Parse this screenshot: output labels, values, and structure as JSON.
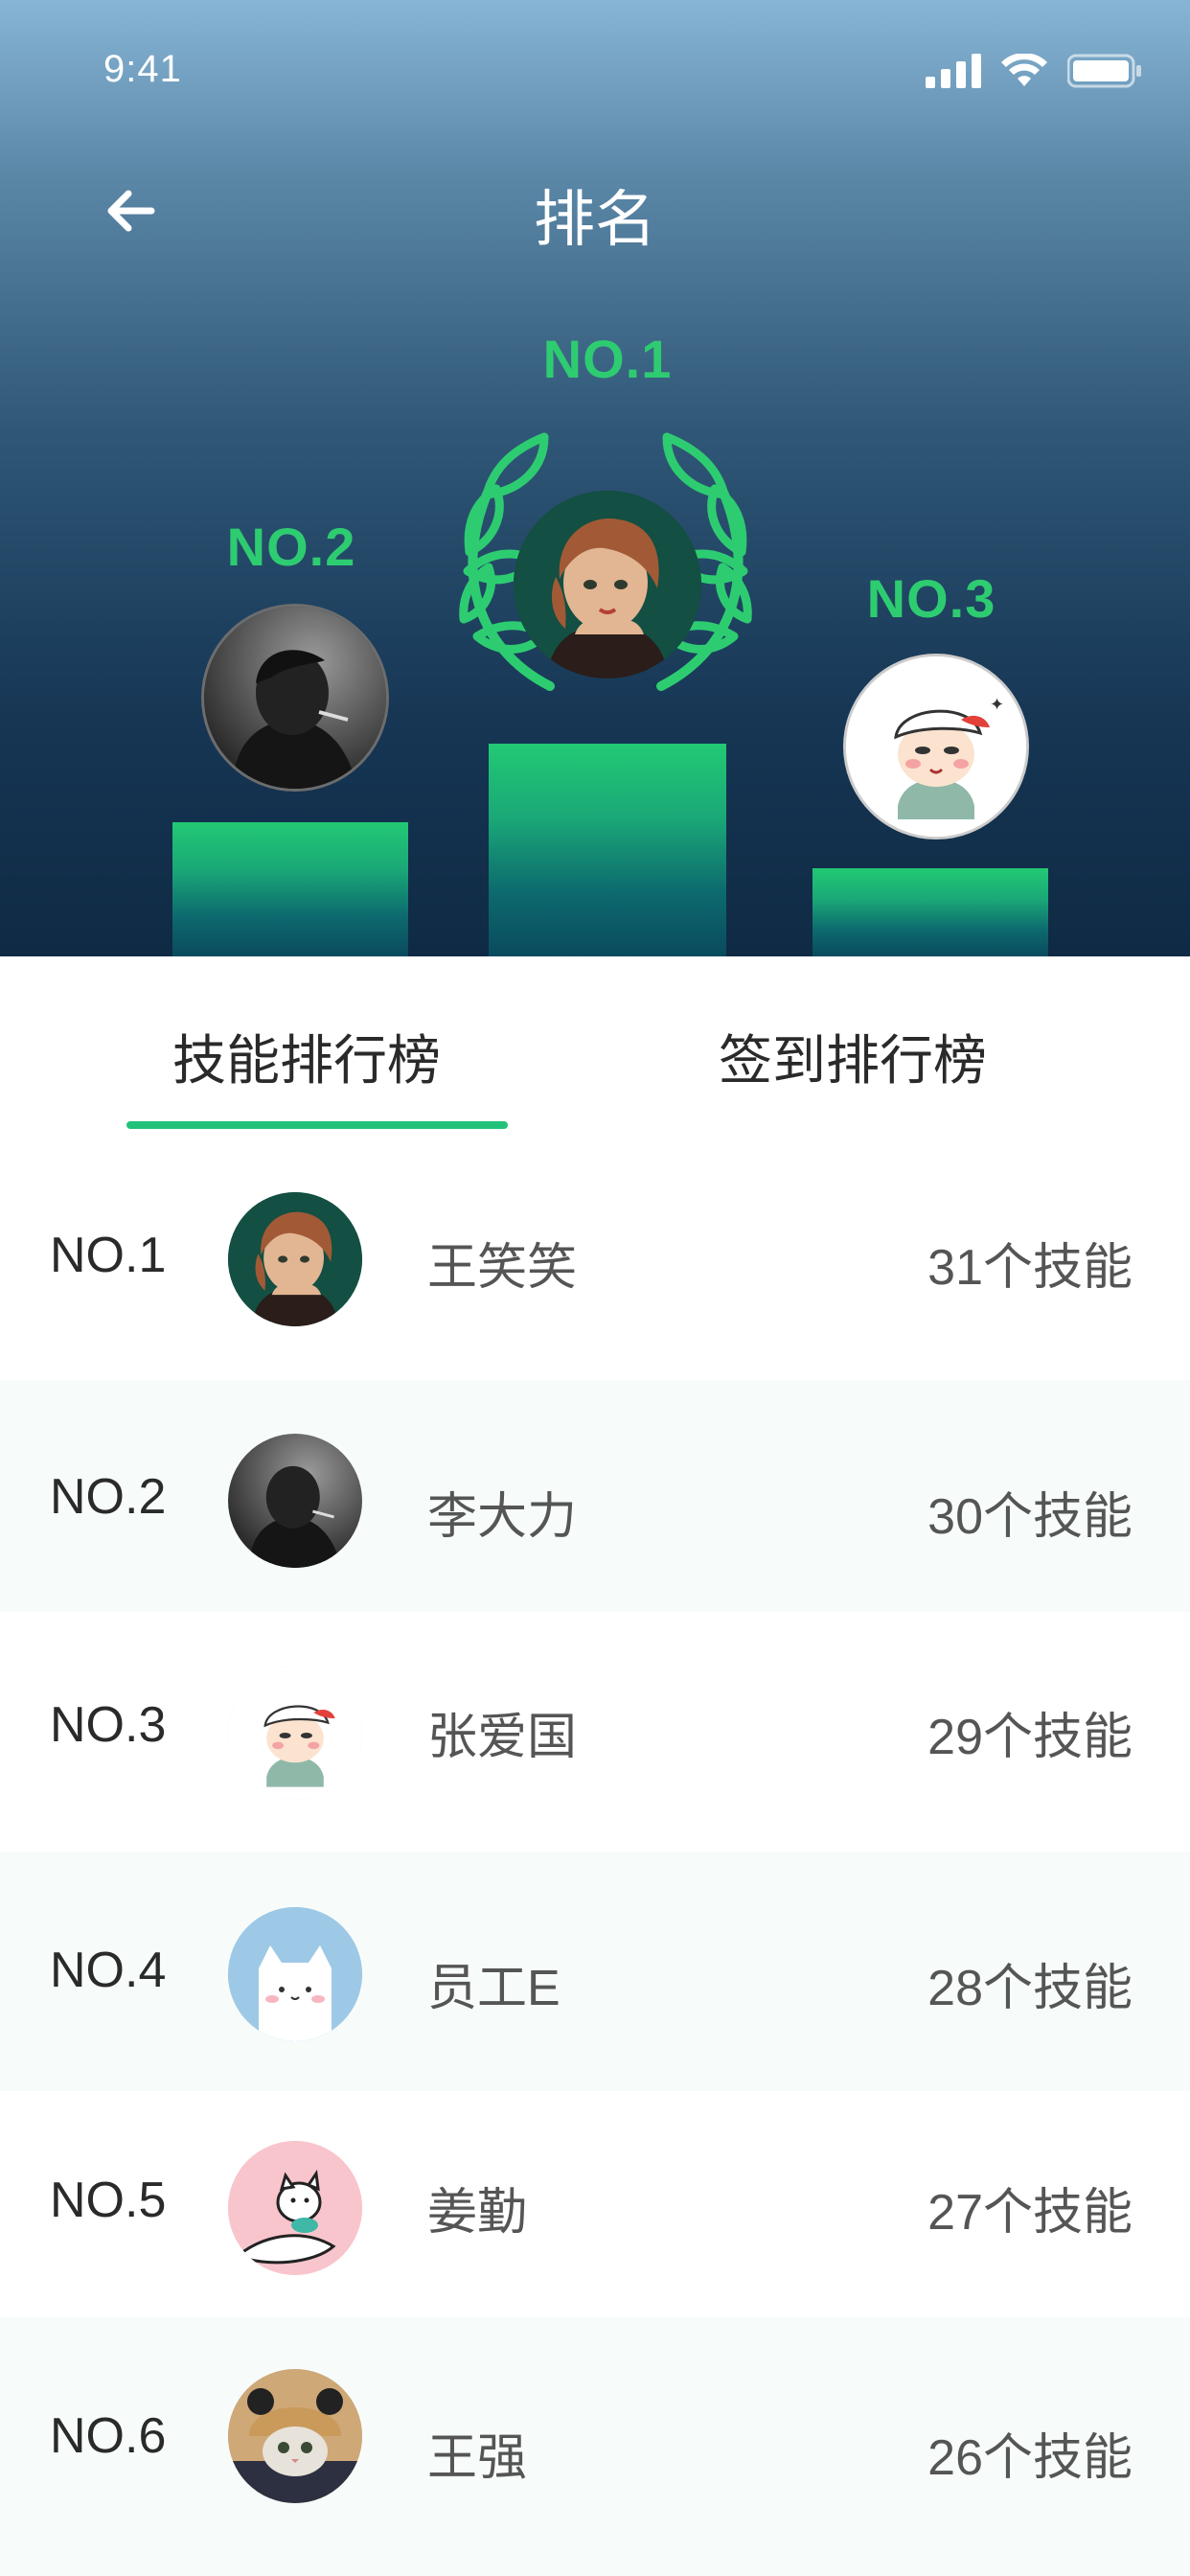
{
  "status_bar": {
    "time": "9:41"
  },
  "nav": {
    "title": "排名"
  },
  "podium": {
    "first": {
      "label": "NO.1"
    },
    "second": {
      "label": "NO.2"
    },
    "third": {
      "label": "NO.3"
    }
  },
  "tabs": [
    {
      "label": "技能排行榜",
      "active": true
    },
    {
      "label": "签到排行榜",
      "active": false
    }
  ],
  "ranking": [
    {
      "rank": "NO.1",
      "name": "王笑笑",
      "count": "31个技能",
      "avatar": "girl-portrait-avatar"
    },
    {
      "rank": "NO.2",
      "name": "李大力",
      "count": "30个技能",
      "avatar": "smoking-man-avatar"
    },
    {
      "rank": "NO.3",
      "name": "张爱国",
      "count": "29个技能",
      "avatar": "cap-boy-avatar"
    },
    {
      "rank": "NO.4",
      "name": "员工E",
      "count": "28个技能",
      "avatar": "white-cat-avatar"
    },
    {
      "rank": "NO.5",
      "name": "姜勤",
      "count": "27个技能",
      "avatar": "squirrel-cartoon-avatar"
    },
    {
      "rank": "NO.6",
      "name": "王强",
      "count": "26个技能",
      "avatar": "kitten-hat-avatar"
    }
  ],
  "colors": {
    "accent": "#22c27a",
    "header_top": "#87b5d5",
    "header_bottom": "#0f2a44",
    "alt_row": "#f7fcfb"
  }
}
